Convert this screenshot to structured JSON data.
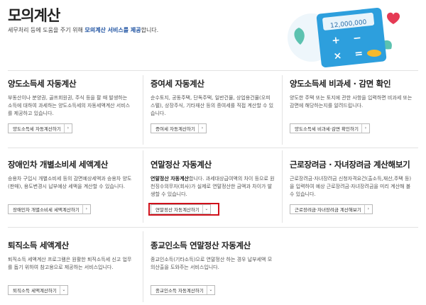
{
  "page": {
    "title": "모의계산",
    "desc_before": "세무처리 등에 도움을 주기 위해 ",
    "desc_highlight": "모의계산 서비스를 제공",
    "desc_after": "합니다."
  },
  "illustration": {
    "amount": "12,000,000"
  },
  "cells": [
    {
      "title": "양도소득세 자동계산",
      "desc": "부동산이나 분양권, 골프회원권, 주식 등을 팔 때 발생하는 소득에 대하여 과세하는 양도소득세의 자동세액계산 서비스를 제공하고 있습니다.",
      "button": "양도소득세 자동계산하기"
    },
    {
      "title": "증여세 자동계산",
      "desc": "순수토지, 공동주택, 단독주택, 일반건물, 상업용건물(오피스텔), 상장주식, 기타재산 등의 증여세를 직접 계산할 수 있습니다.",
      "button": "증여세 자동계산하기"
    },
    {
      "title": "양도소득세 비과세 · 감면 확인",
      "desc": "양도한 주택 또는 토지에 관한 사항을 입력하면 비과세 또는 감면에 해당하는지를 알려드립니다.",
      "button": "양도소득세 비과세·감면 확인하기"
    },
    {
      "title": "장애인차 개별소비세 세액계산",
      "desc": "승용차 구입시 개별소비세 등의 감면예상세액과 승용차 양도(판매), 용도변경시 납부예상 세액을 계산할 수 있습니다.",
      "button": "장애인차 개별소비세 세액계산하기"
    },
    {
      "title": "연말정산 자동계산",
      "desc_bold": "연말정산 자동계산",
      "desc_rest": "합니다. 과세대상급여액의 차이 등으로 원천징수의무자(회사)가 실제로 연말정산한 금액과 차이가 발생할 수 있습니다.",
      "button": "연말정산 자동계산하기"
    },
    {
      "title": "근로장려금 · 자녀장려금 계산해보기",
      "desc": "근로장려금·자녀장려금 신청자격요건(출소득,재산,주택 등)을 입력하여 예상 근로장려금·자녀장려금을 미리 계산해 볼 수 있습니다.",
      "button": "근로장려금·자녀장려금 계산해보기"
    },
    {
      "title": "퇴직소득 세액계산",
      "desc": "퇴직소득 세액계산 프로그램은 원활한 퇴직소득세 신고 업무를 돕기 위하여 참고용으로 제공하는 서비스입니다.",
      "button": "퇴직소득 세액계산하기"
    },
    {
      "title": "종교인소득 연말정산 자동계산",
      "desc": "종교인소득(기타소득)으로 연말정산 하는 경우 납부세액 모의산출을 도와주는 서비스입니다.",
      "button": "종교인소득 자동계산하기"
    }
  ]
}
